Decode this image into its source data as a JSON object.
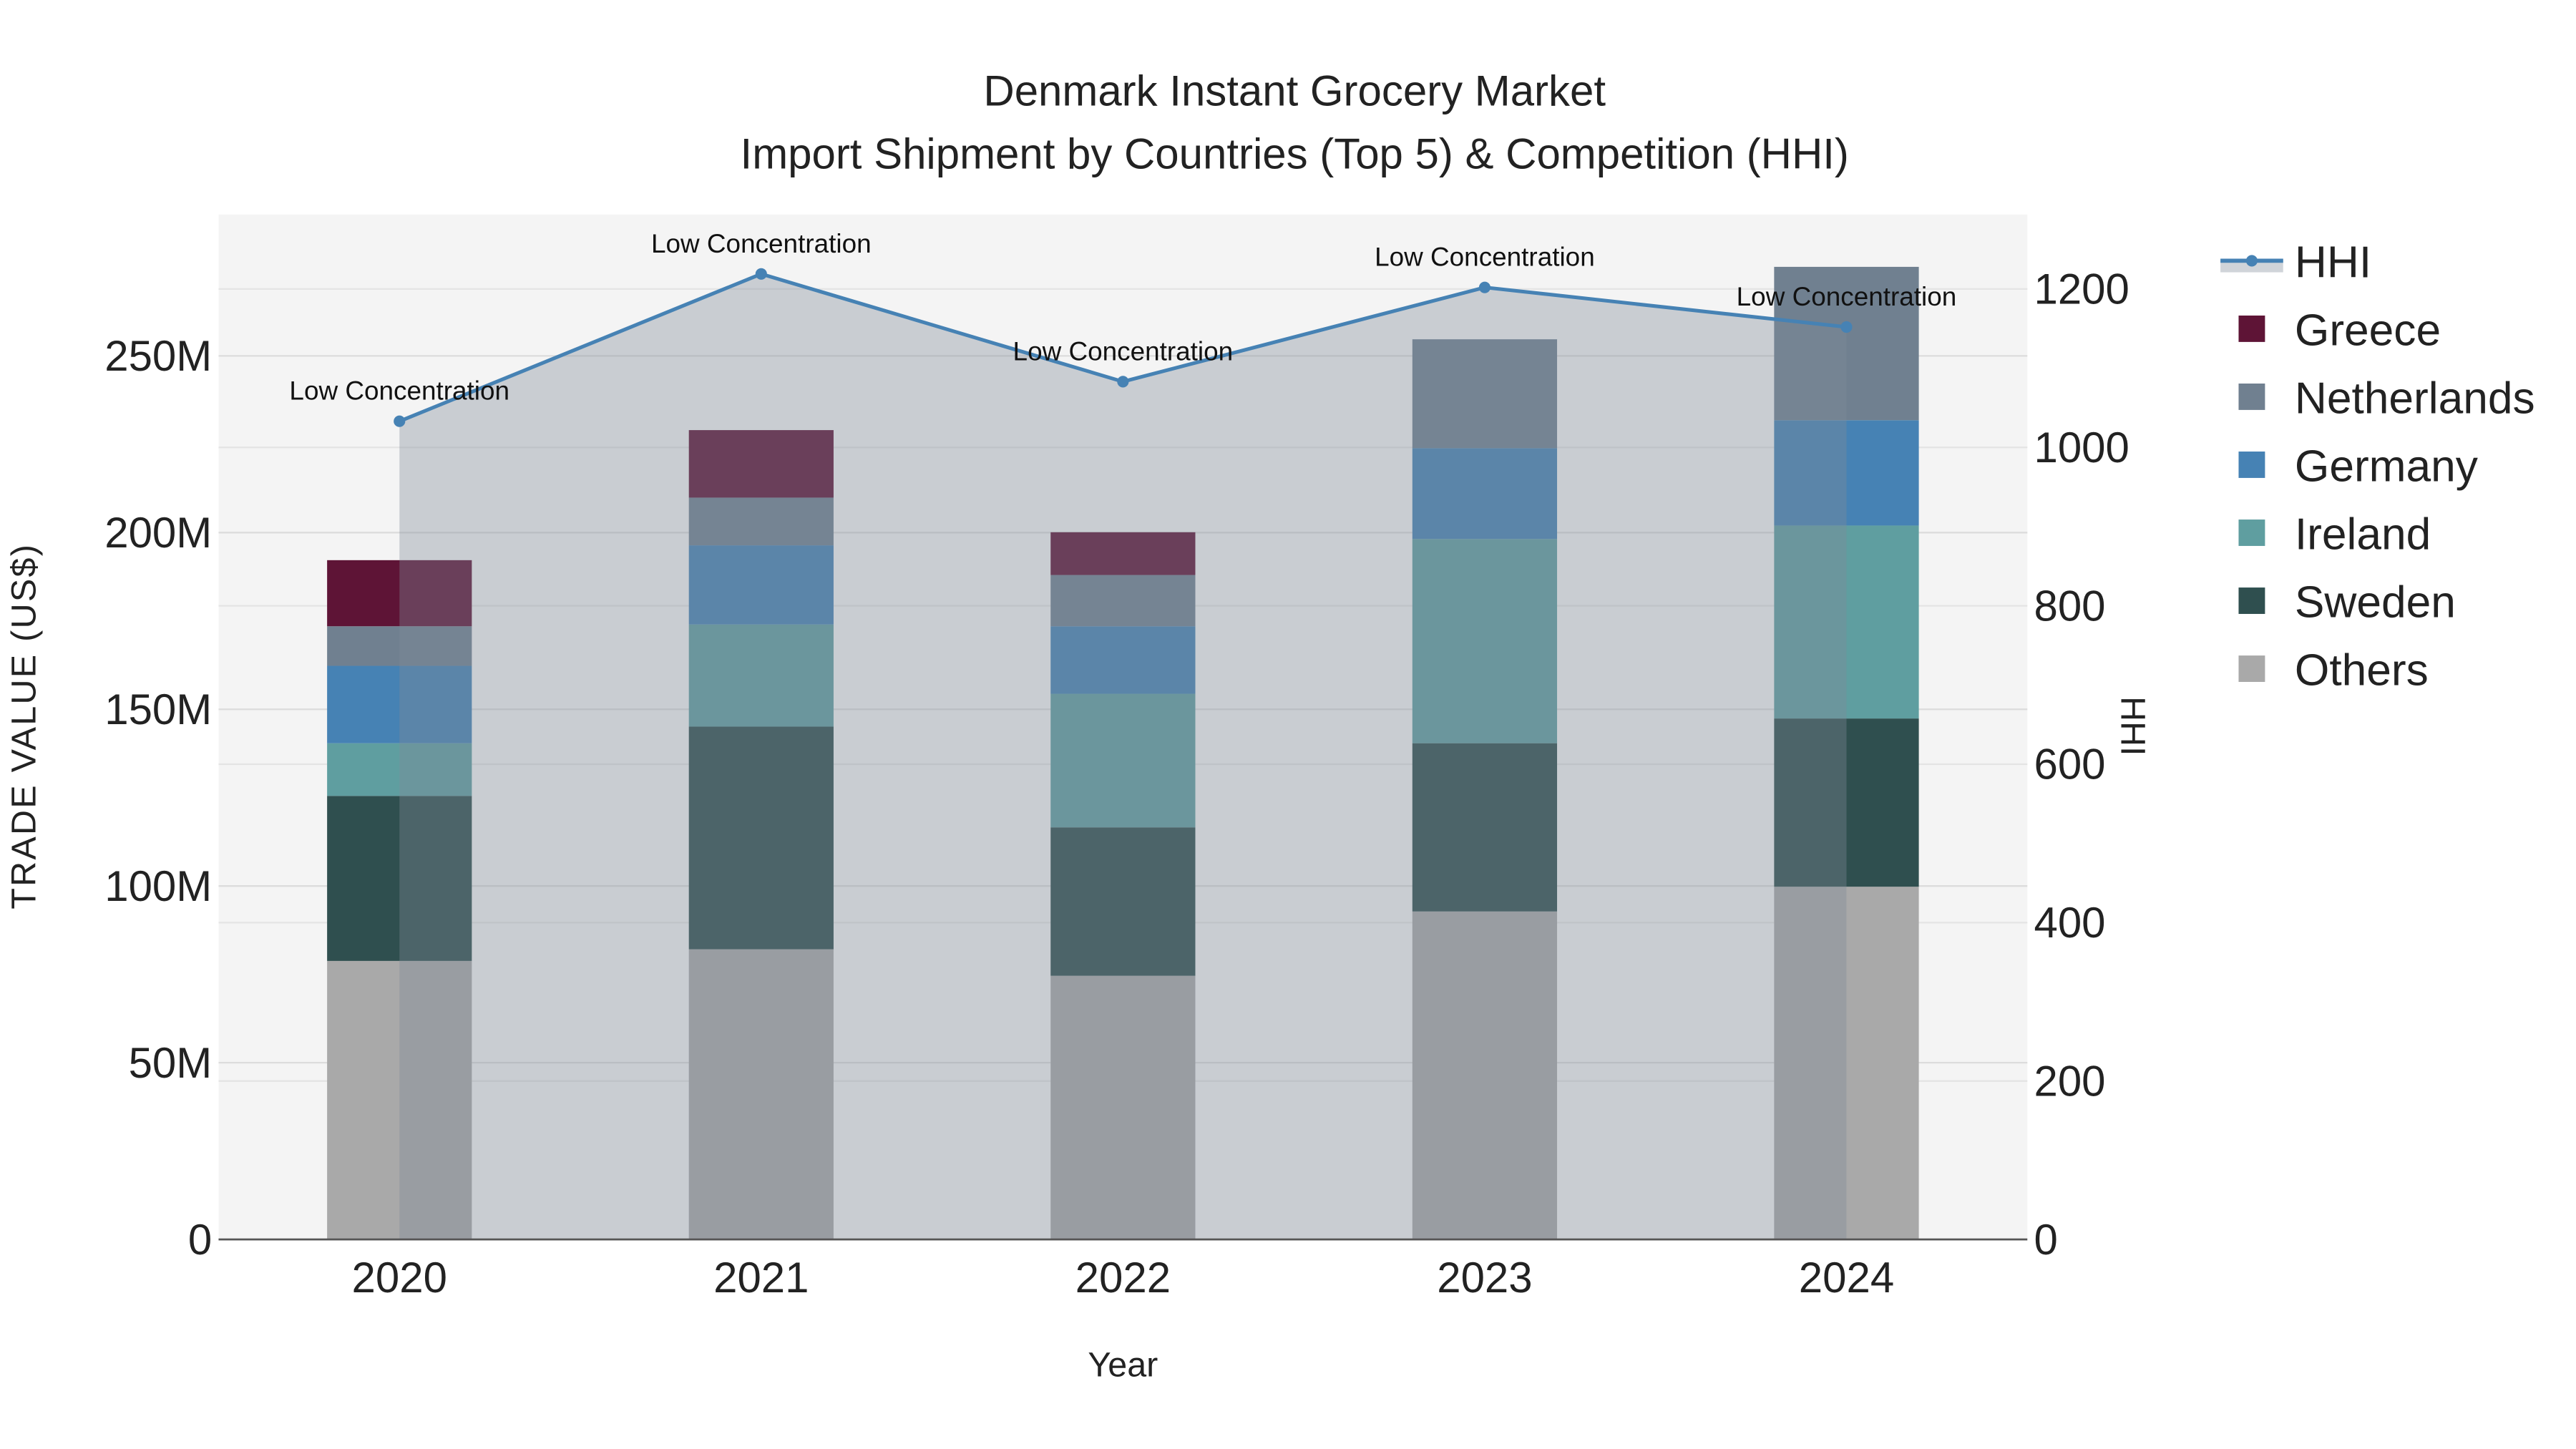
{
  "chart_data": {
    "type": "bar",
    "stacked": true,
    "title": "Denmark Instant Grocery Market",
    "subtitle": "Import Shipment by Countries (Top 5) & Competition (HHI)",
    "xlabel": "Year",
    "ylabel": "TRADE VALUE (US$)",
    "y2label": "HHI",
    "categories": [
      "2020",
      "2021",
      "2022",
      "2023",
      "2024"
    ],
    "ylim": [
      0,
      290
    ],
    "y_unit": "M",
    "yticks": [
      "0",
      "50M",
      "100M",
      "150M",
      "200M",
      "250M"
    ],
    "y2lim": [
      0,
      1294
    ],
    "y2ticks": [
      "0",
      "200",
      "400",
      "600",
      "800",
      "1000",
      "1200"
    ],
    "grid": true,
    "legend_position": "right",
    "series": [
      {
        "name": "Others",
        "color": "#a9a9a9",
        "values": [
          78.8,
          82.1,
          74.6,
          92.8,
          99.8
        ]
      },
      {
        "name": "Sweden",
        "color": "#2f4f4f",
        "values": [
          46.7,
          63.0,
          42.0,
          47.6,
          47.6
        ]
      },
      {
        "name": "Ireland",
        "color": "#5f9ea0",
        "values": [
          14.9,
          28.9,
          37.8,
          57.8,
          54.6
        ]
      },
      {
        "name": "Germany",
        "color": "#4682b4",
        "values": [
          21.9,
          22.4,
          19.1,
          25.7,
          29.8
        ]
      },
      {
        "name": "Netherlands",
        "color": "#708090",
        "values": [
          11.2,
          13.5,
          14.5,
          30.8,
          43.4
        ]
      },
      {
        "name": "Greece",
        "color": "#5e1436",
        "values": [
          18.7,
          19.1,
          12.1,
          0,
          0
        ]
      }
    ],
    "hhi": {
      "name": "HHI",
      "color": "#4682b4",
      "values": [
        1033,
        1219,
        1083,
        1202,
        1152
      ],
      "annotations": [
        "Low Concentration",
        "Low Concentration",
        "Low Concentration",
        "Low Concentration",
        "Low Concentration"
      ]
    },
    "legend": [
      "HHI",
      "Greece",
      "Netherlands",
      "Germany",
      "Ireland",
      "Sweden",
      "Others"
    ]
  }
}
